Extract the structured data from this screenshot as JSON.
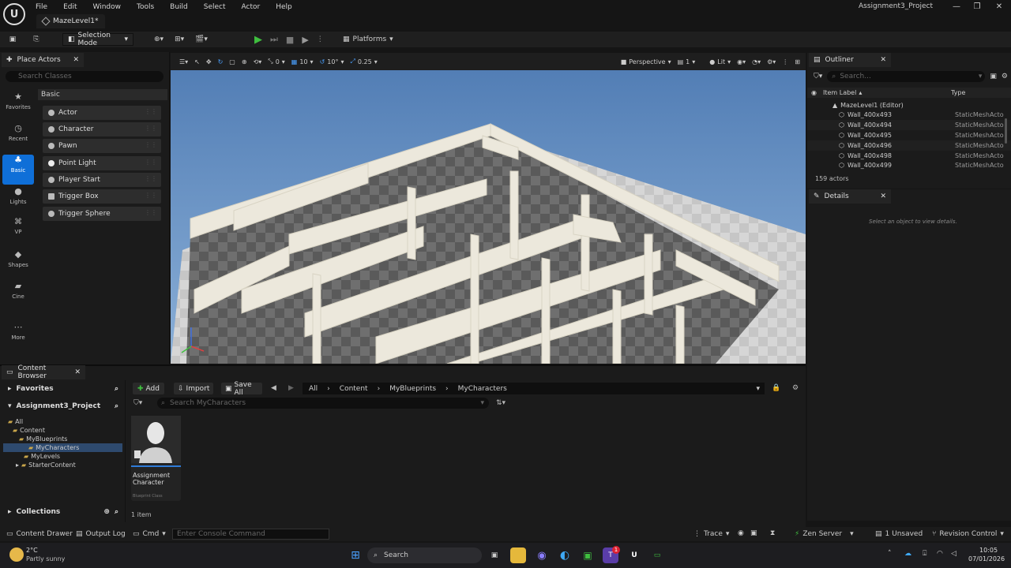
{
  "title_bar": {
    "menu": [
      "File",
      "Edit",
      "Window",
      "Tools",
      "Build",
      "Select",
      "Actor",
      "Help"
    ],
    "level_tab": "MazeLevel1*",
    "project_name": "Assignment3_Project"
  },
  "toolbar": {
    "selection_mode": "Selection Mode",
    "platforms": "Platforms"
  },
  "place_actors": {
    "tab_title": "Place Actors",
    "search_placeholder": "Search Classes",
    "category_header": "Basic",
    "categories": [
      {
        "label": "Favorites",
        "icon": "star-icon"
      },
      {
        "label": "Recent",
        "icon": "clock-icon"
      },
      {
        "label": "Basic",
        "icon": "shapes-basic-icon"
      },
      {
        "label": "Lights",
        "icon": "lightbulb-icon"
      },
      {
        "label": "VP",
        "icon": "vp-icon"
      },
      {
        "label": "Shapes",
        "icon": "cube-icon"
      },
      {
        "label": "Cine",
        "icon": "clapper-icon"
      },
      {
        "label": "More",
        "icon": "ellipsis-icon"
      }
    ],
    "items": [
      "Actor",
      "Character",
      "Pawn",
      "Point Light",
      "Player Start",
      "Trigger Box",
      "Trigger Sphere"
    ]
  },
  "viewport": {
    "translate_snap": "0",
    "grid_snap": "10",
    "rotation_snap": "10°",
    "scale_snap": "0.25",
    "view_mode": "Perspective",
    "lit_mode": "Lit",
    "camera_speed": "1"
  },
  "outliner": {
    "tab_title": "Outliner",
    "search_placeholder": "Search...",
    "col_item_label": "Item Label",
    "col_type": "Type",
    "root": "MazeLevel1 (Editor)",
    "rows": [
      {
        "name": "Wall_400x493",
        "type": "StaticMeshActo"
      },
      {
        "name": "Wall_400x494",
        "type": "StaticMeshActo"
      },
      {
        "name": "Wall_400x495",
        "type": "StaticMeshActo"
      },
      {
        "name": "Wall_400x496",
        "type": "StaticMeshActo"
      },
      {
        "name": "Wall_400x498",
        "type": "StaticMeshActo"
      },
      {
        "name": "Wall_400x499",
        "type": "StaticMeshActo"
      }
    ],
    "actor_count": "159 actors"
  },
  "details": {
    "tab_title": "Details",
    "empty_message": "Select an object to view details."
  },
  "content_browser": {
    "tab_title": "Content Browser",
    "favorites": "Favorites",
    "project": "Assignment3_Project",
    "collections": "Collections",
    "add_label": "Add",
    "import_label": "Import",
    "save_all_label": "Save All",
    "breadcrumbs": [
      "All",
      "Content",
      "MyBlueprints",
      "MyCharacters"
    ],
    "search_placeholder": "Search MyCharacters",
    "tree": [
      "All",
      "Content",
      "MyBlueprints",
      "MyCharacters",
      "MyLevels",
      "StarterContent"
    ],
    "asset_name": "Assignment Character",
    "asset_type": "Blueprint Class",
    "item_count": "1 item"
  },
  "status_bar": {
    "content_drawer": "Content Drawer",
    "output_log": "Output Log",
    "cmd": "Cmd",
    "console_placeholder": "Enter Console Command",
    "trace": "Trace",
    "zen_server": "Zen Server",
    "unsaved": "1 Unsaved",
    "revision_control": "Revision Control"
  },
  "taskbar": {
    "weather_temp": "2°C",
    "weather_desc": "Partly sunny",
    "search": "Search",
    "time": "10:05",
    "date": "07/01/2026",
    "notification_badge": "1"
  }
}
